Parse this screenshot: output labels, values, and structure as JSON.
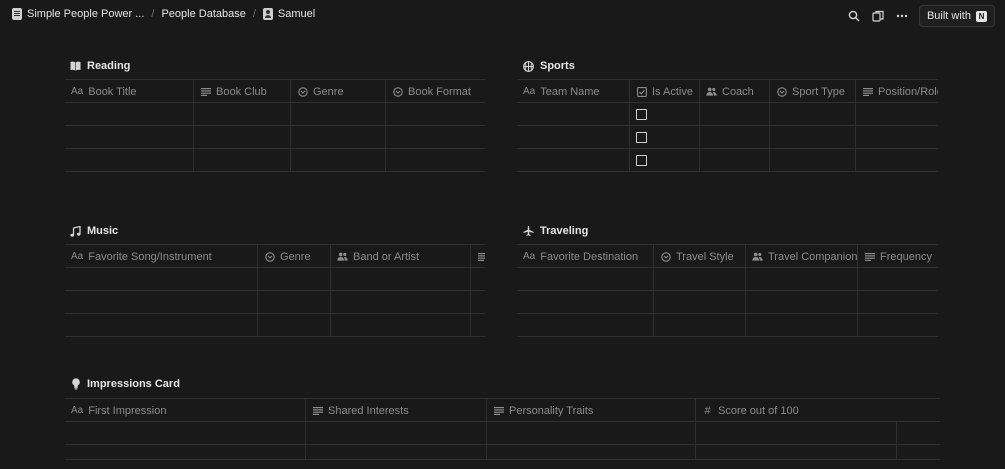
{
  "breadcrumb": {
    "workspace": "Simple People Power ...",
    "database": "People Database",
    "page": "Samuel"
  },
  "topbar": {
    "built_with": "Built with",
    "icons": [
      "search-icon",
      "duplicate-icon",
      "more-icon",
      "notion-logo"
    ]
  },
  "sections": {
    "reading": {
      "title": "Reading",
      "icon": "book-icon",
      "columns": [
        {
          "label": "Book Title",
          "type": "title"
        },
        {
          "label": "Book Club",
          "type": "text"
        },
        {
          "label": "Genre",
          "type": "select"
        },
        {
          "label": "Book Format",
          "type": "select"
        }
      ]
    },
    "sports": {
      "title": "Sports",
      "icon": "basketball-icon",
      "columns": [
        {
          "label": "Team Name",
          "type": "title"
        },
        {
          "label": "Is Active",
          "type": "checkbox"
        },
        {
          "label": "Coach",
          "type": "person"
        },
        {
          "label": "Sport Type",
          "type": "select"
        },
        {
          "label": "Position/Role",
          "type": "text"
        }
      ]
    },
    "music": {
      "title": "Music",
      "icon": "music-note-icon",
      "columns": [
        {
          "label": "Favorite Song/Instrument",
          "type": "title"
        },
        {
          "label": "Genre",
          "type": "select"
        },
        {
          "label": "Band or Artist",
          "type": "person"
        },
        {
          "label": "",
          "type": "text"
        }
      ]
    },
    "traveling": {
      "title": "Traveling",
      "icon": "airplane-icon",
      "columns": [
        {
          "label": "Favorite Destination",
          "type": "title"
        },
        {
          "label": "Travel Style",
          "type": "select"
        },
        {
          "label": "Travel Companion",
          "type": "person"
        },
        {
          "label": "Frequency",
          "type": "text"
        }
      ]
    },
    "impressions": {
      "title": "Impressions Card",
      "icon": "lightbulb-icon",
      "columns": [
        {
          "label": "First Impression",
          "type": "title"
        },
        {
          "label": "Shared Interests",
          "type": "text"
        },
        {
          "label": "Personality Traits",
          "type": "text"
        },
        {
          "label": "Score out of 100",
          "type": "number"
        }
      ]
    }
  },
  "glyphs": {
    "title_prefix": "Aa",
    "number_prefix": "#"
  }
}
